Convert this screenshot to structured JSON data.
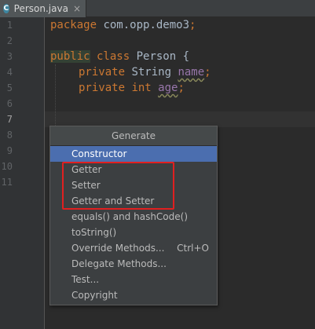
{
  "tab": {
    "icon_letter": "C",
    "label": "Person.java",
    "close": "×"
  },
  "gutter": {
    "line_numbers": [
      "1",
      "2",
      "3",
      "4",
      "5",
      "6",
      "7",
      "8",
      "9",
      "10",
      "11"
    ],
    "current_line": "7"
  },
  "code": {
    "line1": {
      "kw": "package",
      "rest": " com.opp.demo3",
      "semi": ";"
    },
    "line3": {
      "kw1": "public",
      "kw2": " class",
      "rest": " Person {"
    },
    "line4": {
      "kw": "private",
      "type": " String ",
      "field": "name",
      "semi": ";"
    },
    "line5": {
      "kw": "private",
      "type": " int ",
      "field": "age",
      "semi": ";"
    }
  },
  "popup": {
    "title": "Generate",
    "items": [
      {
        "label": "Constructor",
        "shortcut": "",
        "selected": true
      },
      {
        "label": "Getter",
        "shortcut": ""
      },
      {
        "label": "Setter",
        "shortcut": ""
      },
      {
        "label": "Getter and Setter",
        "shortcut": ""
      },
      {
        "label": "equals() and hashCode()",
        "shortcut": ""
      },
      {
        "label": "toString()",
        "shortcut": ""
      },
      {
        "label": "Override Methods...",
        "shortcut": "Ctrl+O"
      },
      {
        "label": "Delegate Methods...",
        "shortcut": ""
      },
      {
        "label": "Test...",
        "shortcut": ""
      },
      {
        "label": "Copyright",
        "shortcut": ""
      }
    ]
  },
  "colors": {
    "background": "#2b2b2b",
    "gutter": "#313335",
    "keyword": "#cc7832",
    "field": "#9876aa",
    "selection": "#4b6eaf",
    "highlight_annotation": "#e02020"
  }
}
